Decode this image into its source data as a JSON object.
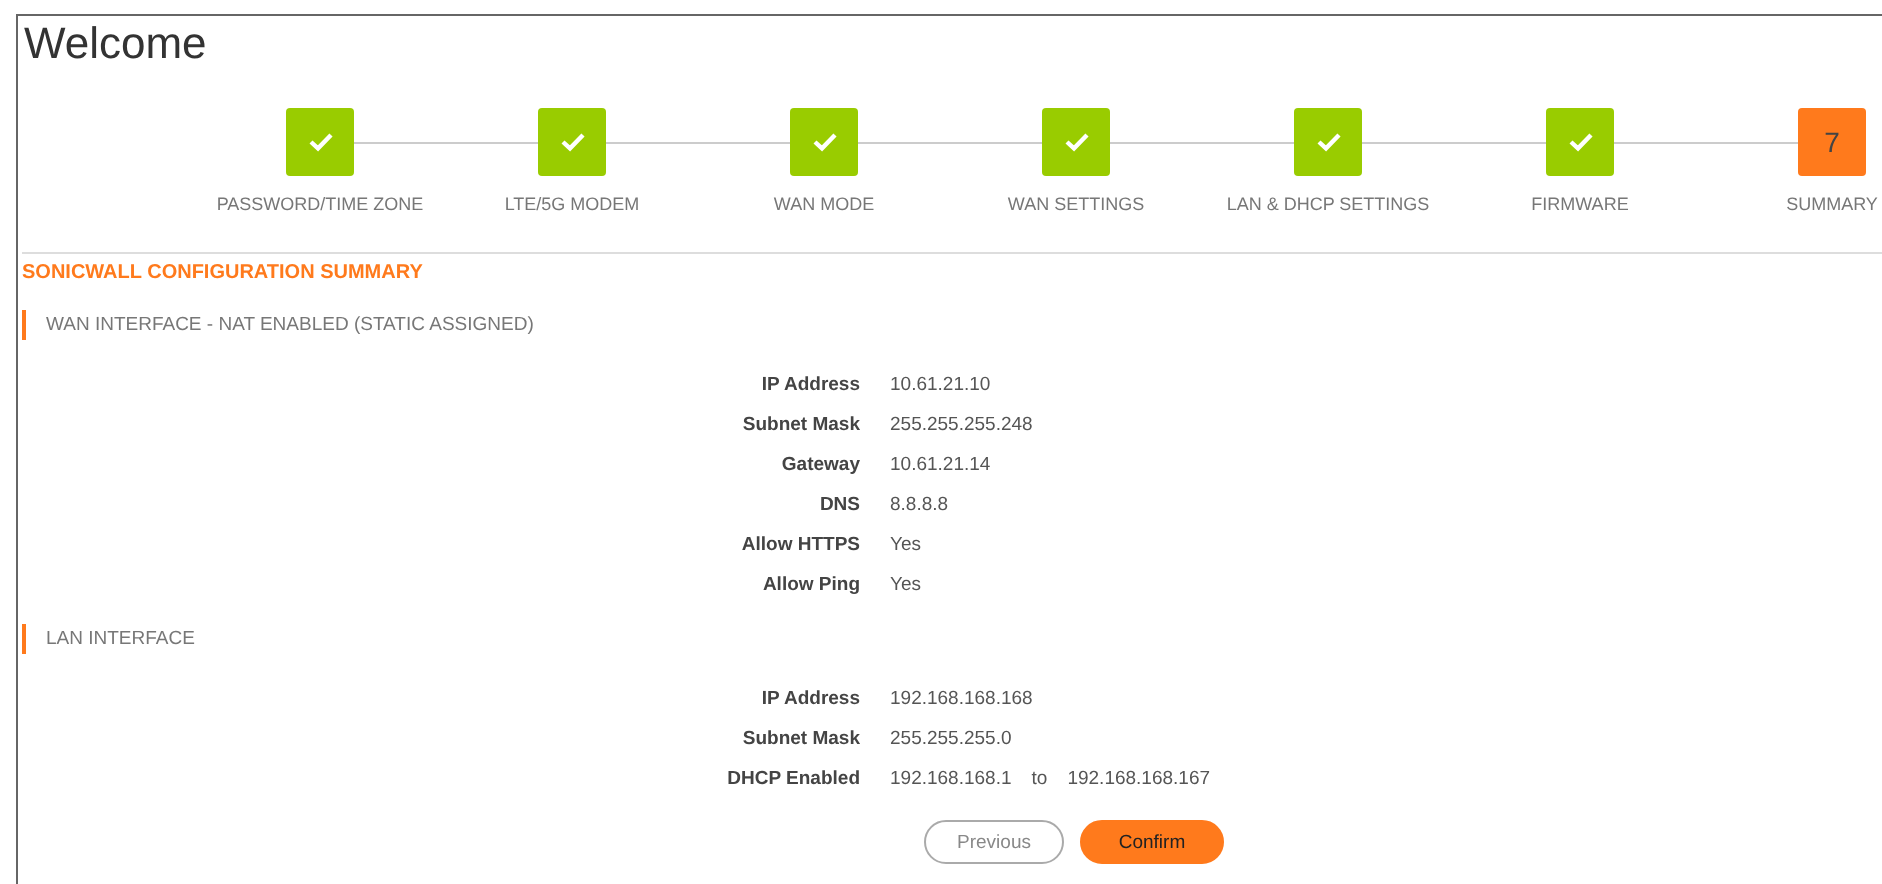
{
  "page_title": "Welcome",
  "steps": [
    {
      "label": "PASSWORD/TIME ZONE",
      "completed": true,
      "selected": false
    },
    {
      "label": "LTE/5G MODEM",
      "completed": true,
      "selected": false
    },
    {
      "label": "WAN MODE",
      "completed": true,
      "selected": false
    },
    {
      "label": "WAN SETTINGS",
      "completed": true,
      "selected": false
    },
    {
      "label": "LAN & DHCP SETTINGS",
      "completed": true,
      "selected": false
    },
    {
      "label": "FIRMWARE",
      "completed": true,
      "selected": false
    },
    {
      "label": "SUMMARY",
      "completed": false,
      "selected": true,
      "number": "7"
    }
  ],
  "summary_heading": "SONICWALL CONFIGURATION SUMMARY",
  "sections": [
    {
      "title": "WAN INTERFACE - NAT ENABLED (STATIC ASSIGNED)",
      "rows": [
        {
          "kind": "single",
          "label": "IP Address",
          "value": "10.61.21.10"
        },
        {
          "kind": "single",
          "label": "Subnet Mask",
          "value": "255.255.255.248"
        },
        {
          "kind": "single",
          "label": "Gateway",
          "value": "10.61.21.14"
        },
        {
          "kind": "single",
          "label": "DNS",
          "value": "8.8.8.8"
        },
        {
          "kind": "single",
          "label": "Allow HTTPS",
          "value": "Yes"
        },
        {
          "kind": "single",
          "label": "Allow Ping",
          "value": "Yes"
        }
      ]
    },
    {
      "title": "LAN INTERFACE",
      "rows": [
        {
          "kind": "single",
          "label": "IP Address",
          "value": "192.168.168.168"
        },
        {
          "kind": "single",
          "label": "Subnet Mask",
          "value": "255.255.255.0"
        },
        {
          "kind": "range",
          "label": "DHCP Enabled",
          "from": "192.168.168.1",
          "separator": "to",
          "to": "192.168.168.167"
        }
      ]
    }
  ],
  "buttons": [
    {
      "label": "Previous",
      "kind": "secondary"
    },
    {
      "label": "Confirm",
      "kind": "primary"
    }
  ]
}
